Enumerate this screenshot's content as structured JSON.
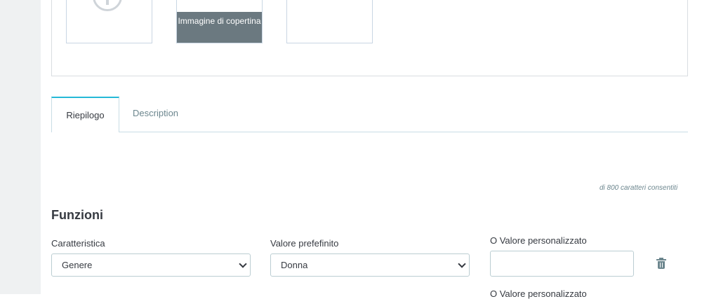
{
  "images": {
    "cover_label": "Immagine di copertina"
  },
  "tabs": [
    {
      "label": "Riepilogo",
      "active": true
    },
    {
      "label": "Description",
      "active": false
    }
  ],
  "summary": {
    "char_counter": "di 800 caratteri consentiti"
  },
  "features": {
    "title": "Funzioni",
    "row": {
      "feature_label": "Caratteristica",
      "feature_value": "Genere",
      "predefined_label": "Valore prefefinito",
      "predefined_value": "Donna",
      "custom_label": "O Valore personalizzato",
      "custom_value": ""
    },
    "next_row_custom_label": "O Valore personalizzato"
  },
  "colors": {
    "accent": "#25b9d7",
    "cover_overlay": "#6b7980",
    "border": "#bbcdd2"
  },
  "icons": {
    "add_image": "plus-circle-icon",
    "delete": "trash-icon",
    "select_arrow": "chevron-down-icon"
  }
}
